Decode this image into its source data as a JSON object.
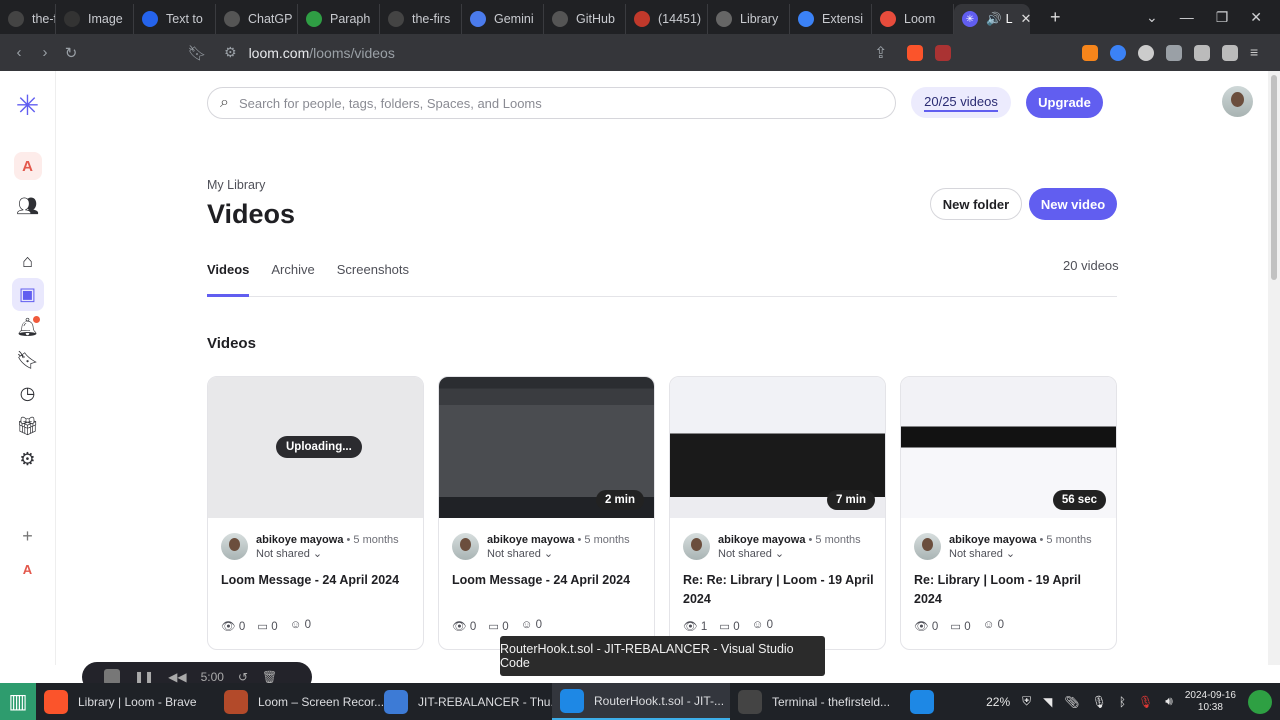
{
  "browser": {
    "tabs": [
      {
        "label": "the-firs",
        "color": "#444"
      },
      {
        "label": "Image",
        "color": "#333"
      },
      {
        "label": "Text to",
        "color": "#2563eb"
      },
      {
        "label": "ChatGP",
        "color": "#555"
      },
      {
        "label": "Paraph",
        "color": "#2f9e44"
      },
      {
        "label": "the-firs",
        "color": "#444"
      },
      {
        "label": "Gemini",
        "color": "#4b7bec"
      },
      {
        "label": "GitHub",
        "color": "#555"
      },
      {
        "label": "(14451)",
        "color": "#c0392b"
      },
      {
        "label": "Library",
        "color": "#666"
      },
      {
        "label": "Extensi",
        "color": "#3b82f6"
      },
      {
        "label": "Loom",
        "color": "#e74c3c"
      }
    ],
    "active_tab": {
      "label": "L",
      "color": "#615ef0"
    },
    "url_host": "loom.com",
    "url_path": "/looms/videos",
    "brave_badge": "10"
  },
  "header": {
    "search_placeholder": "Search for people, tags, folders, Spaces, and Looms",
    "video_quota": "20/25 videos",
    "upgrade_label": "Upgrade"
  },
  "sidebar": {
    "workspace_initial": "A",
    "bottom_initial": "A"
  },
  "page": {
    "breadcrumb": "My Library",
    "title": "Videos",
    "new_folder_label": "New folder",
    "new_video_label": "New video",
    "tabs": [
      "Videos",
      "Archive",
      "Screenshots"
    ],
    "video_count": "20 videos",
    "section_title": "Videos"
  },
  "videos": [
    {
      "status": "Uploading...",
      "owner": "abikoye mayowa",
      "ago": "• 5 months",
      "sharing": "Not shared",
      "title": "Loom Message - 24 April 2024",
      "views": "0",
      "comments": "0",
      "reactions": "0"
    },
    {
      "duration": "2 min",
      "owner": "abikoye mayowa",
      "ago": "• 5 months",
      "sharing": "Not shared",
      "title": "Loom Message - 24 April 2024",
      "views": "0",
      "comments": "0",
      "reactions": "0"
    },
    {
      "duration": "7 min",
      "owner": "abikoye mayowa",
      "ago": "• 5 months",
      "sharing": "Not shared",
      "title": "Re: Re: Library | Loom - 19 April 2024",
      "views": "1",
      "comments": "0",
      "reactions": "0"
    },
    {
      "duration": "56 sec",
      "owner": "abikoye mayowa",
      "ago": "• 5 months",
      "sharing": "Not shared",
      "title": "Re: Library | Loom - 19 April 2024",
      "views": "0",
      "comments": "0",
      "reactions": "0"
    }
  ],
  "tooltip": "RouterHook.t.sol - JIT-REBALANCER - Visual Studio Code",
  "taskbar": {
    "items": [
      {
        "label": "Library | Loom - Brave",
        "color": "#fb542b"
      },
      {
        "label": "Loom – Screen Recor...",
        "color": "#b34a2a"
      },
      {
        "label": "JIT-REBALANCER - Thu...",
        "color": "#3d7bd6"
      },
      {
        "label": "RouterHook.t.sol - JIT-...",
        "color": "#1e88e5"
      },
      {
        "label": "Terminal - thefirsteld...",
        "color": "#444"
      }
    ],
    "battery": "22%",
    "date": "2024-09-16",
    "time": "10:38"
  },
  "recorder": {
    "timer": "5:00"
  }
}
